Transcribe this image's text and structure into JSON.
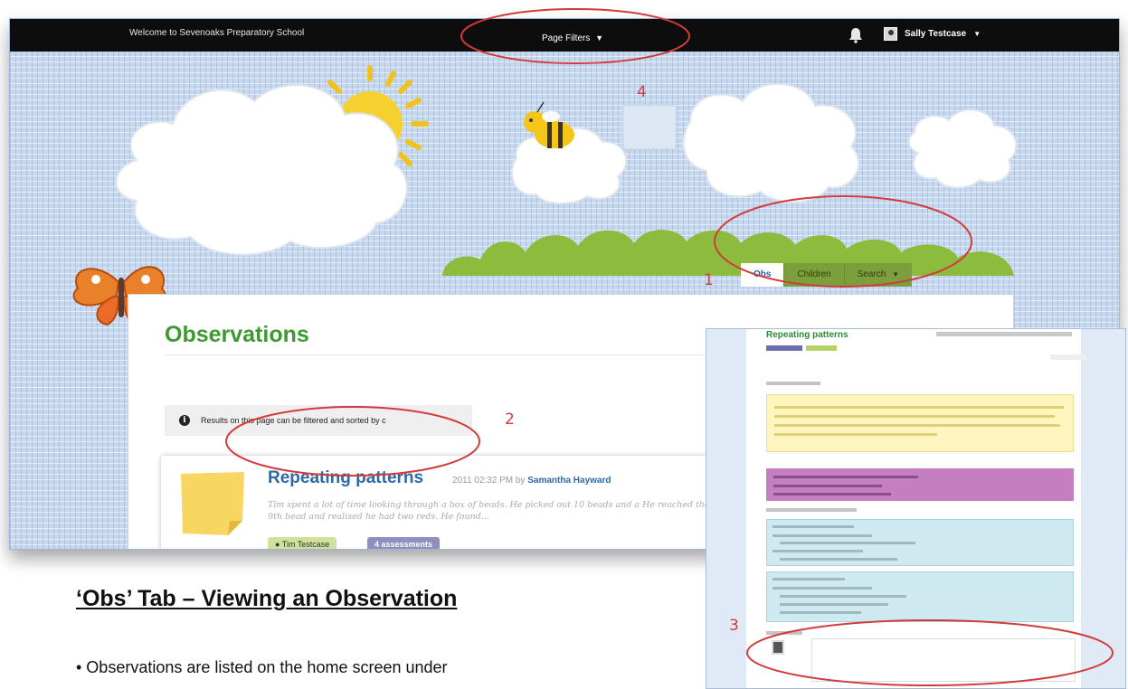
{
  "header": {
    "welcome_text": "Welcome to Sevenoaks Preparatory School",
    "page_filters_label": "Page Filters",
    "user_name": "Sally Testcase"
  },
  "tabs": [
    {
      "label": "Obs",
      "active": true
    },
    {
      "label": "Children",
      "active": false
    },
    {
      "label": "Search",
      "active": false
    }
  ],
  "main": {
    "page_title": "Observations",
    "info_text": "Results on this page can be filtered and sorted by c",
    "observation": {
      "title": "Repeating patterns",
      "date_fragment": "2011 02:32 PM by",
      "author": "Samantha Hayward",
      "excerpt": "Tim spent a lot of time looking through a box of beads. He picked out 10 beads and a He reached the 9th bead and realised he had two reds. He found...",
      "child_chip": "Tim Testcase",
      "assessment_chip": "4 assessments"
    }
  },
  "panel": {
    "title": "Repeating patterns"
  },
  "annotations": {
    "n1": "1",
    "n2": "2",
    "n3": "3",
    "n4": "4",
    "circle_color": "#d23b3b"
  },
  "doc": {
    "heading": "‘Obs’ Tab – Viewing an Observation",
    "bullet": "• Observations are listed on the home screen under"
  },
  "colors": {
    "accent_green": "#3d9a31",
    "link_blue": "#2b6aa8",
    "tab_green": "#7c9e3c",
    "assessment_purple": "#8e8fbe"
  }
}
